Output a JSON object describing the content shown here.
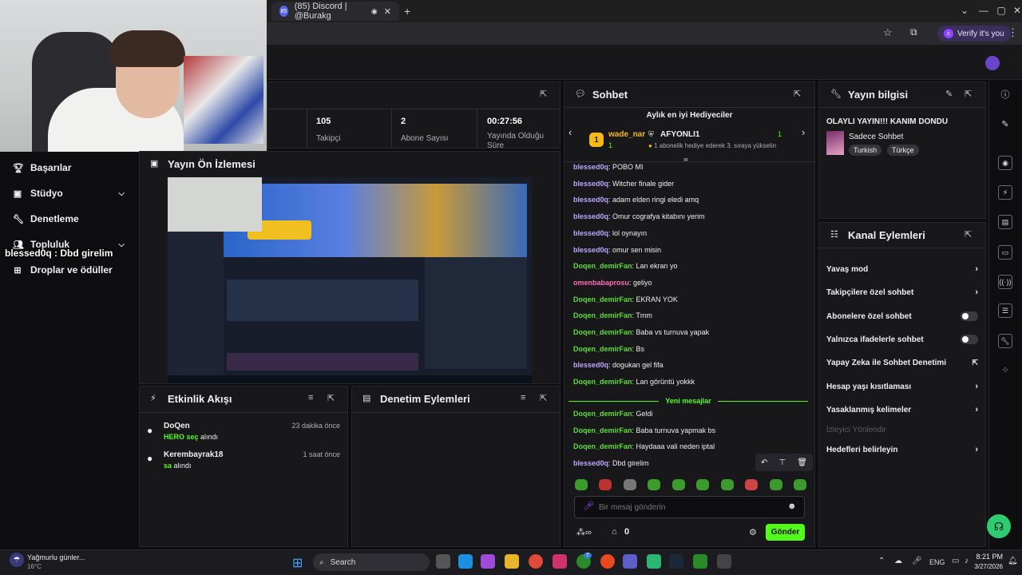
{
  "browser": {
    "tab_title": "(85) Discord | @Burakg",
    "tab_badge": "85",
    "verify_label": "Verify it's you",
    "verify_avatar": "c"
  },
  "sidebar": {
    "items": [
      {
        "label": "Başarılar",
        "icon": "trophy-icon"
      },
      {
        "label": "Stüdyo",
        "icon": "video-icon"
      },
      {
        "label": "Denetleme",
        "icon": "wrench-icon"
      },
      {
        "label": "Topluluk",
        "icon": "people-icon"
      },
      {
        "label": "Droplar ve ödüller",
        "icon": "gift-icon"
      }
    ],
    "overlay_chat": "blessed0q : Dbd girelim"
  },
  "stats": [
    {
      "value": "105",
      "label": "Takipçi"
    },
    {
      "value": "2",
      "label": "Abone Sayısı"
    },
    {
      "value": "00:27:56",
      "label": "Yayında Olduğu Süre"
    }
  ],
  "preview": {
    "title": "Yayın Ön İzlemesi"
  },
  "activity": {
    "title": "Etkinlik Akışı",
    "events": [
      {
        "user": "DoQen",
        "time": "23 dakika önce",
        "detail_hl": "HERO seç",
        "detail": " alındı"
      },
      {
        "user": "Kerembayrak18",
        "time": "1 saat önce",
        "detail_hl": "sa",
        "detail": " alındı"
      }
    ]
  },
  "moderation": {
    "title": "Denetim Eylemleri"
  },
  "chat": {
    "title": "Sohbet",
    "gifters_title": "Aylık en iyi Hediyeciler",
    "gifter_rank": "1",
    "gifter_name": "wade_nar",
    "gifter_count": "1",
    "gifter2_name": "AFYONLI1",
    "gifter2_count": "1",
    "gifter2_note": "1 abonelik hediye ederek 3. sıraya yükselin",
    "messages": [
      {
        "user": "blessed0q",
        "text": "POBO MI",
        "color": "blue"
      },
      {
        "user": "blessed0q",
        "text": "Witcher finale gider",
        "color": "blue"
      },
      {
        "user": "blessed0q",
        "text": "adam elden ringi eledi amq",
        "color": "blue"
      },
      {
        "user": "blessed0q",
        "text": "Omur cografya kitabını yerim",
        "color": "blue"
      },
      {
        "user": "blessed0q",
        "text": "lol oynayın",
        "color": "blue"
      },
      {
        "user": "blessed0q",
        "text": "omur sen misin",
        "color": "blue"
      },
      {
        "user": "Doqen_demirFan",
        "text": "Lan ekran yo",
        "color": "green"
      },
      {
        "user": "omenbabaprosu",
        "text": "geliyo",
        "color": "pink"
      },
      {
        "user": "Doqen_demirFan",
        "text": "EKRAN YOK",
        "color": "green"
      },
      {
        "user": "Doqen_demirFan",
        "text": "Tmm",
        "color": "green"
      },
      {
        "user": "Doqen_demirFan",
        "text": "Baba vs turnuva yapak",
        "color": "green"
      },
      {
        "user": "Doqen_demirFan",
        "text": "Bs",
        "color": "green"
      },
      {
        "user": "blessed0q",
        "text": "dogukan gel fifa",
        "color": "blue"
      },
      {
        "user": "Doqen_demirFan",
        "text": "Lan görüntü yokkk",
        "color": "green"
      }
    ],
    "new_messages_label": "Yeni mesajlar",
    "new_messages": [
      {
        "user": "Doqen_demirFan",
        "text": "Geldi",
        "color": "green"
      },
      {
        "user": "Doqen_demirFan",
        "text": "Baba turnuva yapmak bs",
        "color": "green"
      },
      {
        "user": "Doqen_demirFan",
        "text": "Haydaaa vali neden iptal",
        "color": "green"
      },
      {
        "user": "blessed0q",
        "text": "Dbd girelim",
        "color": "blue"
      }
    ],
    "input_placeholder": "Bir mesaj gönderin",
    "points": "0",
    "send_label": "Gönder"
  },
  "stream_info": {
    "title": "Yayın bilgisi",
    "stream_title": "OLAYLI YAYIN!!! KANIM DONDU",
    "category": "Sadece Sohbet",
    "tags": [
      "Turkish",
      "Türkçe"
    ]
  },
  "channel_actions": {
    "title": "Kanal Eylemleri",
    "items": [
      {
        "label": "Yavaş mod",
        "kind": "chevron"
      },
      {
        "label": "Takipçilere özel sohbet",
        "kind": "chevron"
      },
      {
        "label": "Abonelere özel sohbet",
        "kind": "toggle"
      },
      {
        "label": "Yalnızca ifadelerle sohbet",
        "kind": "toggle"
      },
      {
        "label": "Yapay Zeka ile Sohbet Denetimi",
        "kind": "external"
      },
      {
        "label": "Hesap yaşı kısıtlaması",
        "kind": "chevron"
      },
      {
        "label": "Yasaklanmış kelimeler",
        "kind": "chevron"
      },
      {
        "label": "İzleyici Yönlendir",
        "kind": "disabled"
      },
      {
        "label": "Hedefleri belirleyin",
        "kind": "chevron"
      }
    ]
  },
  "taskbar": {
    "weather_title": "Yağmurlu günler...",
    "weather_temp": "16°C",
    "search_placeholder": "Search",
    "lang": "ENG",
    "time": "8:21 PM",
    "date": "3/27/2026",
    "notif_count": "7"
  },
  "colors": {
    "accent": "#53fc18",
    "purple": "#9146ff",
    "panel": "#18181b"
  }
}
